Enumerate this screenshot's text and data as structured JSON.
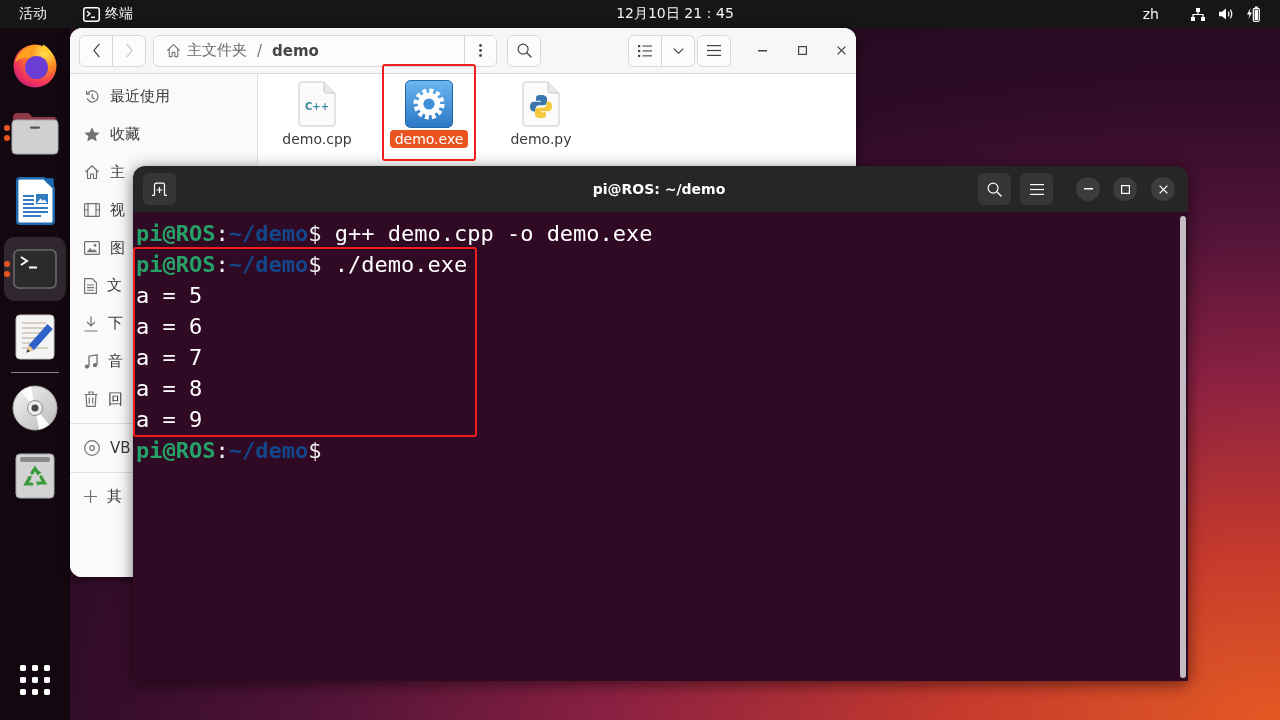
{
  "top_bar": {
    "activities": "活动",
    "app_menu": "终端",
    "clock": "12月10日 21：45",
    "input_method": "zh"
  },
  "dock": {
    "apps": [
      {
        "kind": "browser",
        "running": false,
        "selected": false
      },
      {
        "kind": "files",
        "running": true,
        "selected": false
      },
      {
        "kind": "writer",
        "running": false,
        "selected": false
      },
      {
        "kind": "terminal",
        "running": true,
        "selected": true
      },
      {
        "kind": "text_editor",
        "running": false,
        "selected": false
      }
    ],
    "places": [
      {
        "kind": "disc",
        "running": false,
        "selected": false
      },
      {
        "kind": "trash",
        "running": false,
        "selected": false
      }
    ]
  },
  "files_window": {
    "nav_buttons": [
      {
        "kind": "back",
        "disabled": false
      },
      {
        "kind": "forward",
        "disabled": true
      }
    ],
    "path": {
      "separator": "/",
      "segments": [
        {
          "label": "主文件夹",
          "current": false
        },
        {
          "label": "demo",
          "current": true
        }
      ]
    },
    "sidebar": {
      "sections": [
        {
          "items": [
            {
              "kind": "recent",
              "label": "最近使用",
              "selected": false
            },
            {
              "kind": "starred",
              "label": "收藏",
              "selected": false
            },
            {
              "kind": "home",
              "label": "主",
              "selected": false
            },
            {
              "kind": "videos",
              "label": "视",
              "selected": false
            },
            {
              "kind": "pictures",
              "label": "图",
              "selected": false
            },
            {
              "kind": "documents",
              "label": "文",
              "selected": false
            },
            {
              "kind": "downloads",
              "label": "下",
              "selected": false
            },
            {
              "kind": "music",
              "label": "音",
              "selected": false
            },
            {
              "kind": "trash",
              "label": "回",
              "selected": false
            }
          ]
        },
        {
          "items": [
            {
              "kind": "disc",
              "label": "VB",
              "selected": false
            }
          ]
        },
        {
          "items": [
            {
              "kind": "other",
              "label": "其",
              "selected": false
            }
          ]
        }
      ]
    },
    "files": [
      {
        "name": "demo.cpp",
        "kind": "cpp",
        "icon_label": "C++",
        "selected": false,
        "highlighted": false
      },
      {
        "name": "demo.exe",
        "kind": "executable",
        "selected": true,
        "highlighted": true
      },
      {
        "name": "demo.py",
        "kind": "python",
        "selected": false,
        "highlighted": false
      }
    ]
  },
  "terminal": {
    "title": "pi@ROS: ~/demo",
    "lines": [
      {
        "kind": "prompt",
        "user": "pi@ROS",
        "separator": ":",
        "path": "~/demo",
        "symbol": "$",
        "command": "g++ demo.cpp -o demo.exe",
        "highlighted": false
      },
      {
        "kind": "prompt",
        "user": "pi@ROS",
        "separator": ":",
        "path": "~/demo",
        "symbol": "$",
        "command": "./demo.exe",
        "highlighted": true
      },
      {
        "kind": "output",
        "text": "a = 5",
        "highlighted": true
      },
      {
        "kind": "output",
        "text": "a = 6",
        "highlighted": true
      },
      {
        "kind": "output",
        "text": "a = 7",
        "highlighted": true
      },
      {
        "kind": "output",
        "text": "a = 8",
        "highlighted": true
      },
      {
        "kind": "output",
        "text": "a = 9",
        "highlighted": true
      },
      {
        "kind": "prompt",
        "user": "pi@ROS",
        "separator": ":",
        "path": "~/demo",
        "symbol": "$",
        "highlighted": false
      }
    ]
  }
}
